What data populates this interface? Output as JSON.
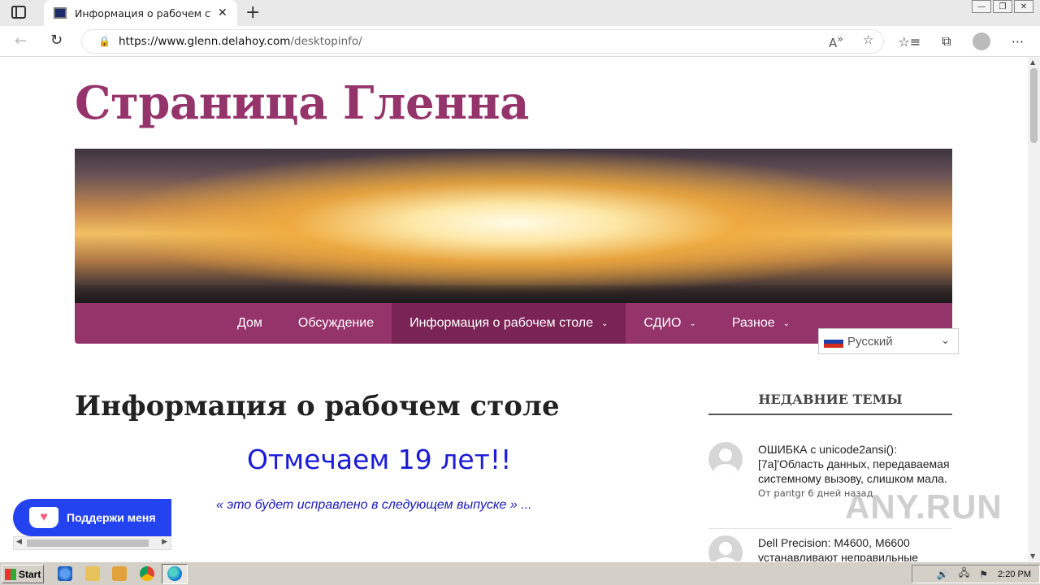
{
  "browser": {
    "tab_title": "Информация о рабочем столе",
    "url_domain": "https://www.glenn.delahoy.com",
    "url_path": "/desktopinfo/"
  },
  "site": {
    "title": "Страница Гленна"
  },
  "menu": {
    "items": [
      {
        "label": "Дом",
        "has_dropdown": false
      },
      {
        "label": "Обсуждение",
        "has_dropdown": false
      },
      {
        "label": "Информация о рабочем столе",
        "has_dropdown": true,
        "active": true
      },
      {
        "label": "СДИО",
        "has_dropdown": true
      },
      {
        "label": "Разное",
        "has_dropdown": true
      }
    ]
  },
  "language": {
    "selected": "Русский"
  },
  "content": {
    "heading": "Информация о рабочем столе",
    "celebrate": "Отмечаем 19 лет!!",
    "quote": "« это будет исправлено в следующем выпуске » ..."
  },
  "support": {
    "label": "Поддержи меня"
  },
  "sidebar": {
    "title": "НЕДАВНИЕ ТЕМЫ",
    "topics": [
      {
        "title": "ОШИБКА с unicode2ansi(): [7a]'Область данных, передаваемая системному вызову, слишком мала.",
        "meta": "От pantgr 6 дней назад"
      },
      {
        "title": "Dell Precision: M4600, M6600 устанавливают неправильные",
        "meta": ""
      }
    ]
  },
  "watermark": "ANY.RUN",
  "taskbar": {
    "start_label": "Start",
    "clock": "2:20 PM"
  },
  "colors": {
    "brand": "#95336b",
    "brand_active": "#7a2455",
    "support_blue": "#2443f0",
    "celebrate_blue": "#1a1ad8"
  }
}
